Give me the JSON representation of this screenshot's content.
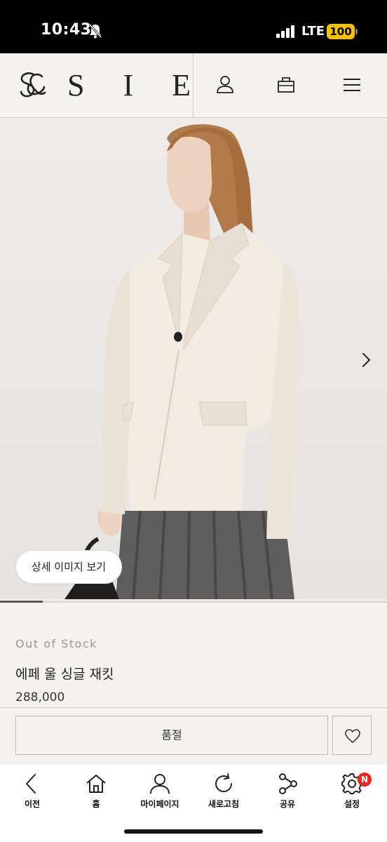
{
  "status_bar": {
    "time": "10:43",
    "network": "LTE",
    "battery": "100"
  },
  "header": {
    "logo_text": "S I E"
  },
  "product": {
    "detail_button": "상세 이미지 보기",
    "image_progress": 0.11,
    "stock_status": "Out of Stock",
    "name": "에페 울 싱글 재킷",
    "price": "288,000",
    "soldout_label": "품절"
  },
  "bottom_nav": {
    "items": [
      {
        "label": "이전",
        "icon": "back-icon"
      },
      {
        "label": "홈",
        "icon": "home-icon"
      },
      {
        "label": "마이페이지",
        "icon": "person-icon"
      },
      {
        "label": "새로고침",
        "icon": "refresh-icon"
      },
      {
        "label": "공유",
        "icon": "share-icon"
      },
      {
        "label": "설정",
        "icon": "settings-icon",
        "badge": "N"
      }
    ]
  },
  "colors": {
    "background": "#f3f2ee",
    "badge": "#e8281f",
    "battery": "#f2c200"
  }
}
